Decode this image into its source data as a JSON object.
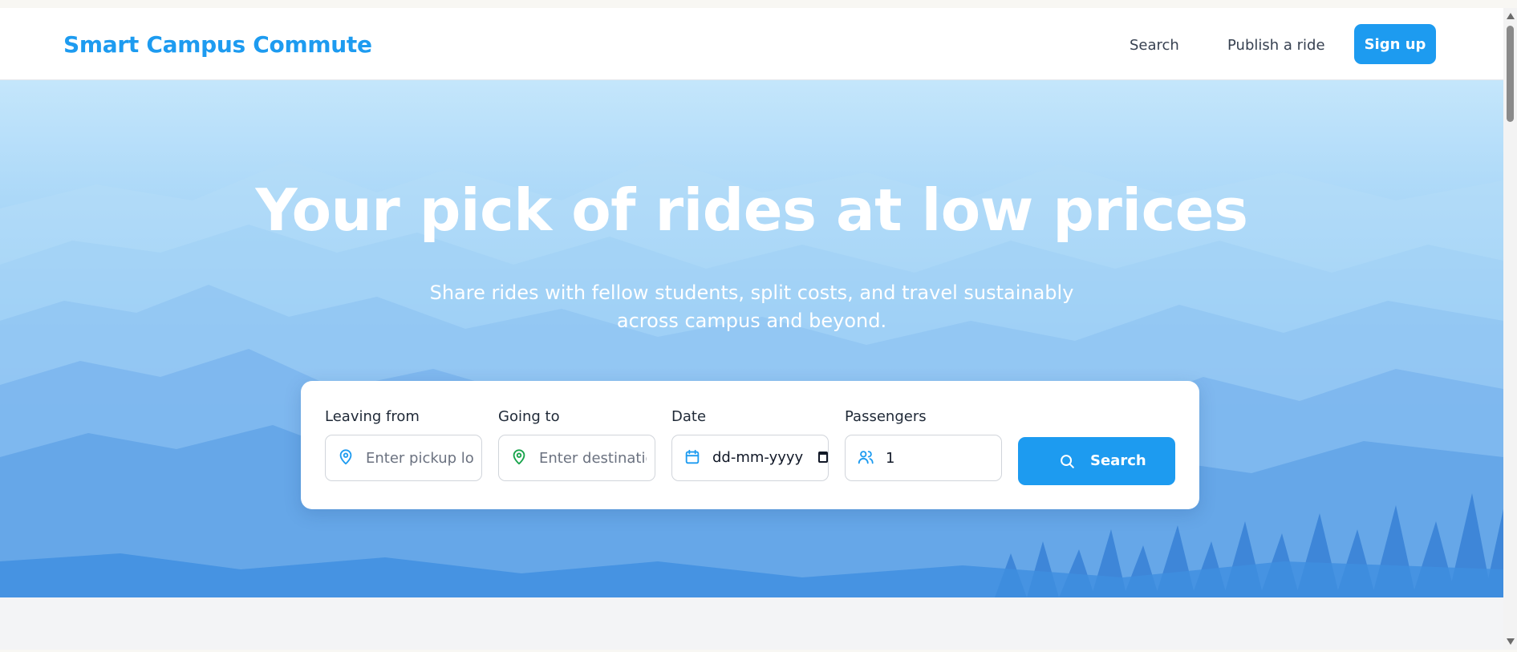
{
  "nav": {
    "brand": "Smart Campus Commute",
    "links": [
      {
        "label": "Search"
      },
      {
        "label": "Publish a ride"
      }
    ],
    "signup_label": "Sign up"
  },
  "hero": {
    "title": "Your pick of rides at low prices",
    "subtitle": "Share rides with fellow students, split costs, and travel sustainably across campus and beyond."
  },
  "search_form": {
    "leaving_from": {
      "label": "Leaving from",
      "placeholder": "Enter pickup location",
      "icon": "map-pin-icon"
    },
    "going_to": {
      "label": "Going to",
      "placeholder": "Enter destination",
      "icon": "map-pin-icon"
    },
    "date": {
      "label": "Date",
      "value": "dd-mm-yyyy",
      "icon": "calendar-icon"
    },
    "passengers": {
      "label": "Passengers",
      "value": "1",
      "icon": "users-icon"
    },
    "submit_label": "Search",
    "submit_icon": "search-icon"
  },
  "colors": {
    "brand": "#1d9bf0",
    "pin_blue": "#1d9bf0",
    "pin_green": "#16a34a",
    "hero_top": "#c4e6fb",
    "hero_bottom": "#3f8fe0"
  }
}
